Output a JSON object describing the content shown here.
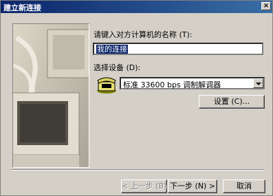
{
  "window": {
    "title": "建立新连接",
    "close_glyph": "×"
  },
  "form": {
    "name_label": "请键入对方计算机的名称 (T):",
    "name_value": "我的连接",
    "device_label": "选择设备 (D):",
    "device_value": "标准 33600 bps 调制解调器",
    "configure_button": "设置 (C)..."
  },
  "buttons": {
    "back": "< 上一步 (B)",
    "next": "下一步 (N) >",
    "cancel": "取消"
  }
}
